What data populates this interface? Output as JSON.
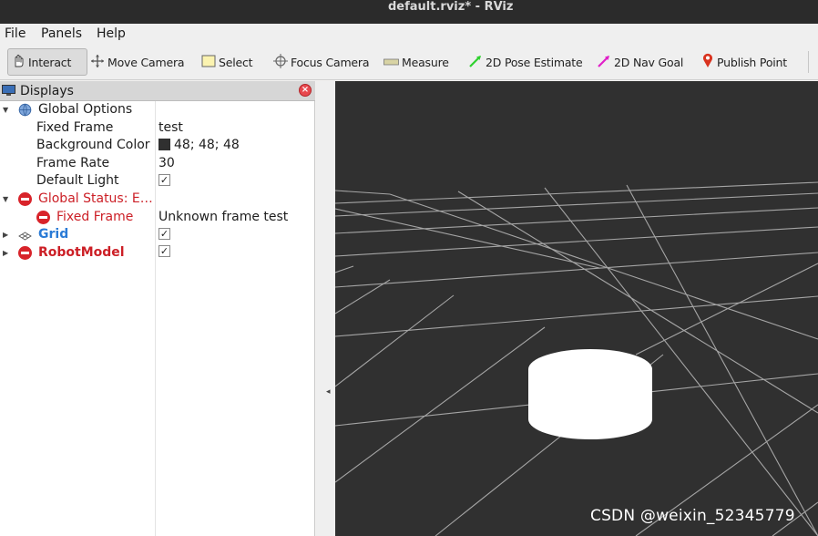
{
  "window": {
    "title": "default.rviz* - RViz"
  },
  "menu": [
    {
      "label": "File"
    },
    {
      "label": "Panels"
    },
    {
      "label": "Help"
    }
  ],
  "toolbar": [
    {
      "label": "Interact",
      "icon": "hand-pointer-icon",
      "active": true
    },
    {
      "label": "Move Camera",
      "icon": "move-camera-icon"
    },
    {
      "label": "Select",
      "icon": "select-rect-icon"
    },
    {
      "label": "Focus Camera",
      "icon": "focus-crosshair-icon"
    },
    {
      "label": "Measure",
      "icon": "ruler-icon"
    },
    {
      "label": "2D Pose Estimate",
      "icon": "green-arrow-icon",
      "color": "#2fd12f"
    },
    {
      "label": "2D Nav Goal",
      "icon": "magenta-arrow-icon",
      "color": "#e020c8"
    },
    {
      "label": "Publish Point",
      "icon": "map-pin-icon",
      "color": "#d9331f"
    }
  ],
  "displays": {
    "title": "Displays",
    "global_options": {
      "label": "Global Options",
      "fixed_frame": {
        "name": "Fixed Frame",
        "value": "test"
      },
      "background_color": {
        "name": "Background Color",
        "value": "48; 48; 48",
        "color": "#303030"
      },
      "frame_rate": {
        "name": "Frame Rate",
        "value": "30"
      },
      "default_light": {
        "name": "Default Light",
        "checked": true
      }
    },
    "global_status": {
      "label": "Global Status: E…",
      "fixed_frame": {
        "name": "Fixed Frame",
        "value": "Unknown frame test"
      }
    },
    "grid": {
      "label": "Grid",
      "checked": true
    },
    "robot_model": {
      "label": "RobotModel",
      "checked": true
    }
  },
  "viewport": {
    "background": "#303030"
  },
  "watermark": "CSDN @weixin_52345779"
}
